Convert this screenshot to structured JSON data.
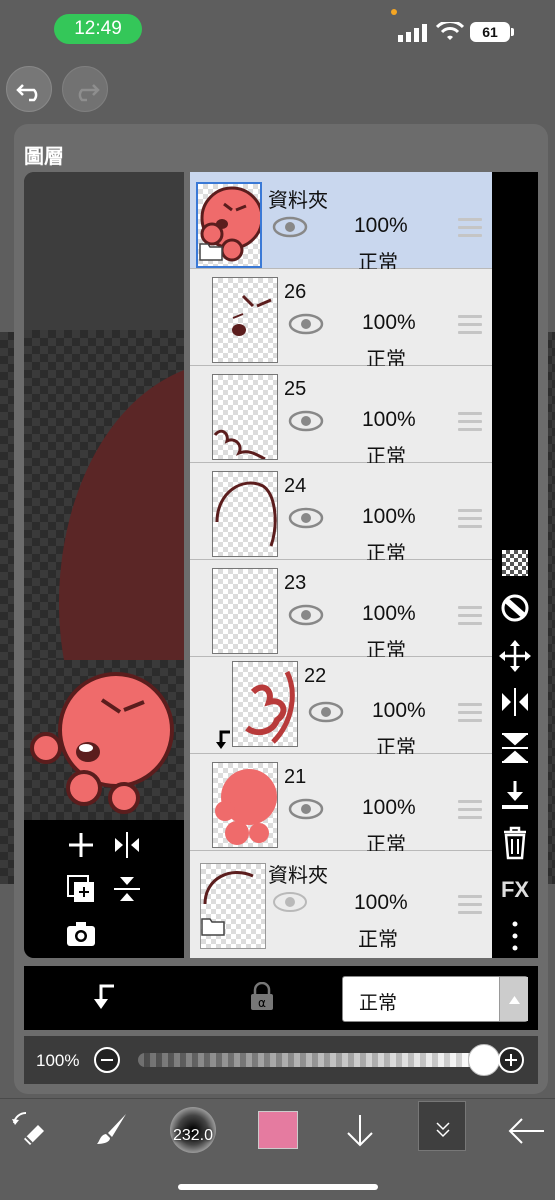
{
  "status_bar": {
    "time": "12:49",
    "battery": "61"
  },
  "panel": {
    "title": "圖層"
  },
  "layers": [
    {
      "name": "資料夾",
      "opacity": "100%",
      "mode": "正常",
      "type": "folder",
      "selected": true
    },
    {
      "name": "26",
      "opacity": "100%",
      "mode": "正常"
    },
    {
      "name": "25",
      "opacity": "100%",
      "mode": "正常"
    },
    {
      "name": "24",
      "opacity": "100%",
      "mode": "正常"
    },
    {
      "name": "23",
      "opacity": "100%",
      "mode": "正常"
    },
    {
      "name": "22",
      "opacity": "100%",
      "mode": "正常",
      "clipped": true
    },
    {
      "name": "21",
      "opacity": "100%",
      "mode": "正常"
    },
    {
      "name": "資料夾",
      "opacity": "100%",
      "mode": "正常",
      "type": "folder"
    }
  ],
  "side_tools": [
    "checker-icon",
    "mask-icon",
    "move-icon",
    "flip-horizontal-icon",
    "flip-vertical-icon",
    "merge-down-icon",
    "trash-icon",
    "fx-label",
    "more-icon"
  ],
  "side_fx_label": "FX",
  "blend": {
    "selected": "正常"
  },
  "opacity_slider": {
    "label": "100%",
    "value": 1.0
  },
  "toolbar": {
    "brush_size": "232.0",
    "color": "#e57ba0"
  },
  "colors": {
    "accent": "#34c759",
    "selected_row": "#c9d7ee",
    "character": "#ef6b6b"
  }
}
